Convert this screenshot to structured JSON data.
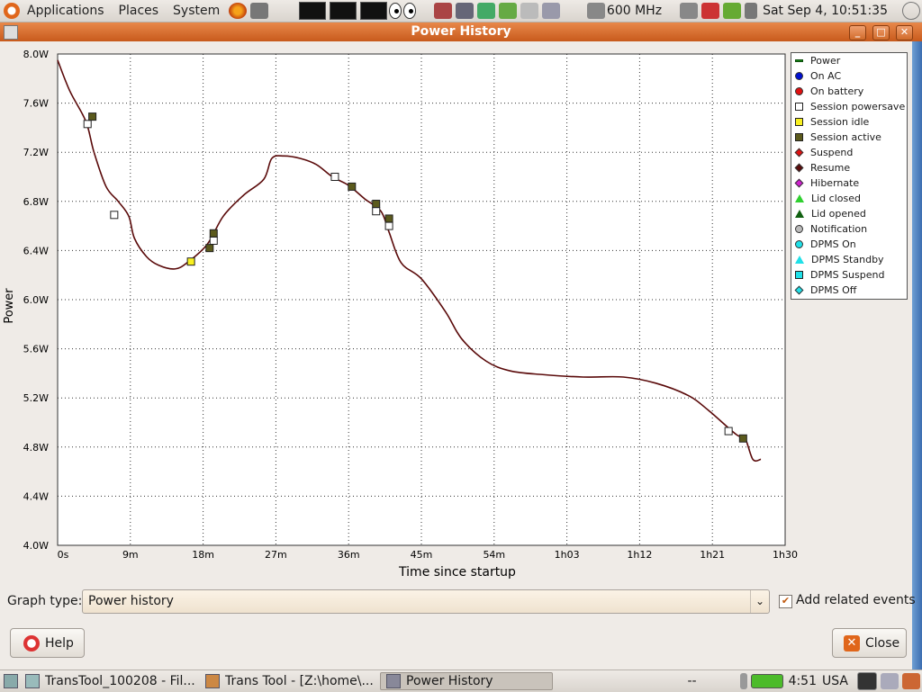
{
  "top_panel": {
    "menus": [
      "Applications",
      "Places",
      "System"
    ],
    "cpu_freq": "600 MHz",
    "clock": "Sat Sep  4, 10:51:35"
  },
  "window": {
    "title": "Power History",
    "title_buttons": [
      "_",
      "□",
      "✕"
    ]
  },
  "chart_data": {
    "type": "line",
    "ylabel": "Power",
    "xlabel": "Time since startup",
    "ylim": [
      4.0,
      8.0
    ],
    "xlim_minutes": [
      0,
      90
    ],
    "y_ticks": [
      "8.0W",
      "7.6W",
      "7.2W",
      "6.8W",
      "6.4W",
      "6.0W",
      "5.6W",
      "5.2W",
      "4.8W",
      "4.4W",
      "4.0W"
    ],
    "x_ticks": [
      "0s",
      "9m",
      "18m",
      "27m",
      "36m",
      "45m",
      "54m",
      "1h03",
      "1h12",
      "1h21",
      "1h30"
    ],
    "grid": true,
    "legend_placement": "right",
    "series": [
      {
        "name": "Power",
        "color": "#5a0a0a",
        "x_minutes": [
          0,
          1.5,
          3.5,
          4.5,
          6,
          7.5,
          8.8,
          9.5,
          11,
          12.5,
          14.5,
          16,
          18.5,
          20.5,
          23,
          25.5,
          26.5,
          28,
          30,
          32,
          34,
          36,
          38,
          40,
          41,
          42.5,
          45,
          48,
          50,
          53,
          56,
          60,
          65,
          70,
          74,
          78,
          80.5,
          84,
          85,
          86,
          87
        ],
        "values": [
          7.95,
          7.7,
          7.45,
          7.2,
          6.92,
          6.8,
          6.68,
          6.5,
          6.35,
          6.28,
          6.25,
          6.3,
          6.45,
          6.68,
          6.85,
          6.98,
          7.15,
          7.17,
          7.15,
          7.1,
          7.0,
          6.93,
          6.82,
          6.72,
          6.55,
          6.3,
          6.17,
          5.9,
          5.68,
          5.5,
          5.42,
          5.39,
          5.37,
          5.37,
          5.32,
          5.22,
          5.1,
          4.9,
          4.88,
          4.7,
          4.7
        ]
      }
    ],
    "events": [
      {
        "type": "Session powersave",
        "x_minutes": 3.7,
        "y": 7.43
      },
      {
        "type": "Session active",
        "x_minutes": 4.3,
        "y": 7.49
      },
      {
        "type": "Session powersave",
        "x_minutes": 7,
        "y": 6.69
      },
      {
        "type": "Session idle",
        "x_minutes": 16.5,
        "y": 6.31
      },
      {
        "type": "Session active",
        "x_minutes": 18.8,
        "y": 6.42
      },
      {
        "type": "Session powersave",
        "x_minutes": 19.3,
        "y": 6.48
      },
      {
        "type": "Session active",
        "x_minutes": 19.3,
        "y": 6.54
      },
      {
        "type": "Session powersave",
        "x_minutes": 34.3,
        "y": 7.0
      },
      {
        "type": "Session active",
        "x_minutes": 36.4,
        "y": 6.92
      },
      {
        "type": "Session powersave",
        "x_minutes": 39.4,
        "y": 6.72
      },
      {
        "type": "Session active",
        "x_minutes": 39.4,
        "y": 6.78
      },
      {
        "type": "Session powersave",
        "x_minutes": 41.0,
        "y": 6.6
      },
      {
        "type": "Session active",
        "x_minutes": 41.0,
        "y": 6.66
      },
      {
        "type": "Session powersave",
        "x_minutes": 83.0,
        "y": 4.93
      },
      {
        "type": "Session active",
        "x_minutes": 84.8,
        "y": 4.87
      }
    ],
    "legend": [
      {
        "label": "Power",
        "shape": "line",
        "color": "#1a8a1a"
      },
      {
        "label": "On AC",
        "shape": "circle",
        "color": "#0010d0"
      },
      {
        "label": "On battery",
        "shape": "circle",
        "color": "#e01010"
      },
      {
        "label": "Session powersave",
        "shape": "square",
        "color": "#ffffff"
      },
      {
        "label": "Session idle",
        "shape": "square",
        "color": "#f8f020"
      },
      {
        "label": "Session active",
        "shape": "square",
        "color": "#5b5a1c"
      },
      {
        "label": "Suspend",
        "shape": "diamond",
        "color": "#e01010"
      },
      {
        "label": "Resume",
        "shape": "diamond",
        "color": "#5a0a0a"
      },
      {
        "label": "Hibernate",
        "shape": "diamond",
        "color": "#d020d0"
      },
      {
        "label": "Lid closed",
        "shape": "triangle",
        "color": "#30d030"
      },
      {
        "label": "Lid opened",
        "shape": "triangle",
        "color": "#106010"
      },
      {
        "label": "Notification",
        "shape": "circle",
        "color": "#bbbbbb"
      },
      {
        "label": "DPMS On",
        "shape": "circle",
        "color": "#20e0e8"
      },
      {
        "label": "DPMS Standby",
        "shape": "triangle",
        "color": "#20e0e8"
      },
      {
        "label": "DPMS Suspend",
        "shape": "square",
        "color": "#20e0e8"
      },
      {
        "label": "DPMS Off",
        "shape": "diamond",
        "color": "#20e0e8"
      }
    ]
  },
  "controls": {
    "graph_type_label": "Graph type:",
    "graph_type_value": "Power history",
    "add_related_events_label": "Add related events",
    "add_related_events_checked": true,
    "help_label": "Help",
    "close_label": "Close"
  },
  "bottom_panel": {
    "tasks": [
      "TransTool_100208 - Fil...",
      "Trans Tool - [Z:\\home\\...",
      "Power History"
    ],
    "separator_text": "--",
    "battery_time": "4:51",
    "keyboard_layout": "USA"
  }
}
